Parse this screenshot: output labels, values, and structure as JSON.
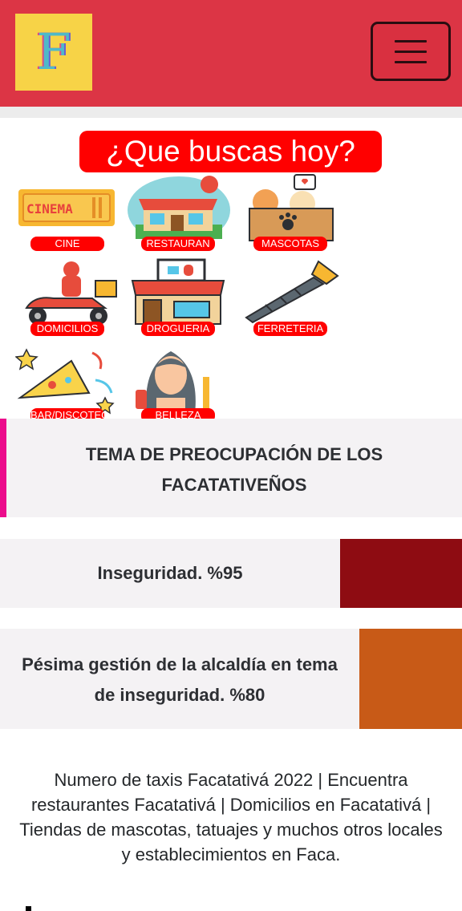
{
  "header": {
    "logo_letter": "F",
    "menu_icon": "hamburger-icon",
    "brand_color": "#dc3545"
  },
  "headline": "¿Que buscas hoy?",
  "categories": [
    {
      "label": "CINE",
      "icon": "cinema-ticket-icon"
    },
    {
      "label": "RESTAURAN",
      "icon": "restaurant-icon"
    },
    {
      "label": "MASCOTAS",
      "icon": "pets-icon"
    },
    {
      "label": "DOMICILIOS",
      "icon": "delivery-scooter-icon"
    },
    {
      "label": "DROGUERIA",
      "icon": "pharmacy-icon"
    },
    {
      "label": "FERRETERIA",
      "icon": "screw-icon"
    },
    {
      "label": "BAR/DISCOTECA",
      "icon": "party-hat-icon"
    },
    {
      "label": "BELLEZA",
      "icon": "beauty-woman-icon"
    }
  ],
  "notice": {
    "title": "TEMA DE PREOCUPACIÓN DE LOS FACATATIVEÑOS",
    "accent": "#ec0c8c"
  },
  "stats": [
    {
      "text": "Inseguridad. %95",
      "color": "#8e0c12"
    },
    {
      "text": "Pésima gestión de la alcaldía en tema de inseguridad. %80",
      "color": "#c85a17"
    }
  ],
  "footer_text": "Numero de taxis Facatativá 2022 | Encuentra restaurantes Facatativá | Domicilios en Facatativá | Tiendas de mascotas, tatuajes y muchos otros locales y establecimientos en Faca."
}
